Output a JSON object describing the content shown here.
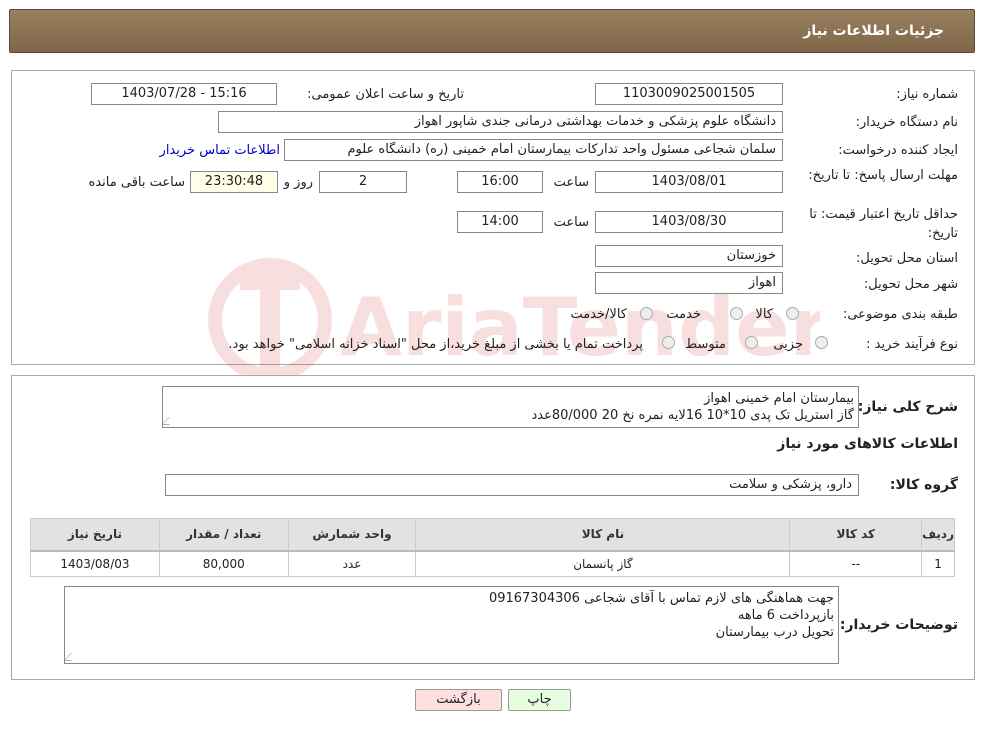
{
  "header": {
    "title": "جزئیات اطلاعات نیاز"
  },
  "labels": {
    "need_number": "شماره نیاز:",
    "announce_datetime": "تاریخ و ساعت اعلان عمومی:",
    "buyer_org": "نام دستگاه خریدار:",
    "requester": "ایجاد کننده درخواست:",
    "buyer_contact": "اطلاعات تماس خریدار",
    "reply_deadline": "مهلت ارسال پاسخ: تا تاریخ:",
    "time_word": "ساعت",
    "day_and": "روز و",
    "remaining": "ساعت باقی مانده",
    "price_validity": "حداقل تاریخ اعتبار قیمت: تا تاریخ:",
    "province": "استان محل تحویل:",
    "city": "شهر محل تحویل:",
    "category": "طبقه بندی موضوعی:",
    "process": "نوع فرآیند خرید :",
    "general_desc": "شرح کلی نیاز:",
    "goods_info": "اطلاعات کالاهای مورد نیاز",
    "goods_group": "گروه کالا:",
    "buyer_notes": "توضیحات خریدار:"
  },
  "values": {
    "need_number": "1103009025001505",
    "announce_datetime": "1403/07/28 - 15:16",
    "buyer_org": "دانشگاه علوم پزشکی و خدمات بهداشتی درمانی جندی شاپور اهواز",
    "requester": "سلمان شجاعی مسئول واحد تدارکات بیمارستان امام خمینی (ره) دانشگاه علوم",
    "reply_date": "1403/08/01",
    "reply_time": "16:00",
    "reply_days": "2",
    "reply_remaining": "23:30:48",
    "price_date": "1403/08/30",
    "price_time": "14:00",
    "province": "خوزستان",
    "city": "اهواز",
    "desc_line1": "بیمارستان امام خمینی اهواز",
    "desc_line2": "گاز استریل تک پدی 10*10 16لایه نمره نخ 20       80/000عدد",
    "goods_group": "دارو، پزشکی و سلامت",
    "notes_line1": "جهت هماهنگی های لازم تماس با آقای شجاعی 09167304306",
    "notes_line2": "بازپرداخت 6 ماهه",
    "notes_line3": "تحویل درب بیمارستان"
  },
  "category_options": [
    {
      "label": "کالا",
      "checked": false
    },
    {
      "label": "خدمت",
      "checked": false
    },
    {
      "label": "کالا/خدمت",
      "checked": false
    }
  ],
  "process_options": [
    {
      "label": "جزیی",
      "checked": false
    },
    {
      "label": "متوسط",
      "checked": false
    }
  ],
  "process_note": "پرداخت تمام یا بخشی از مبلغ خرید،از محل \"اسناد خزانه اسلامی\" خواهد بود.",
  "table": {
    "headers": [
      "ردیف",
      "کد کالا",
      "نام کالا",
      "واحد شمارش",
      "تعداد / مقدار",
      "تاریخ نیاز"
    ],
    "rows": [
      [
        "1",
        "--",
        "گاز پانسمان",
        "عدد",
        "80,000",
        "1403/08/03"
      ]
    ]
  },
  "buttons": {
    "print": "چاپ",
    "back": "بازگشت"
  },
  "watermark": {
    "text": "AriaTender.net"
  },
  "colors": {
    "title_bar": "#8b7355",
    "link": "#0000cc",
    "watermark": "#c00000"
  }
}
